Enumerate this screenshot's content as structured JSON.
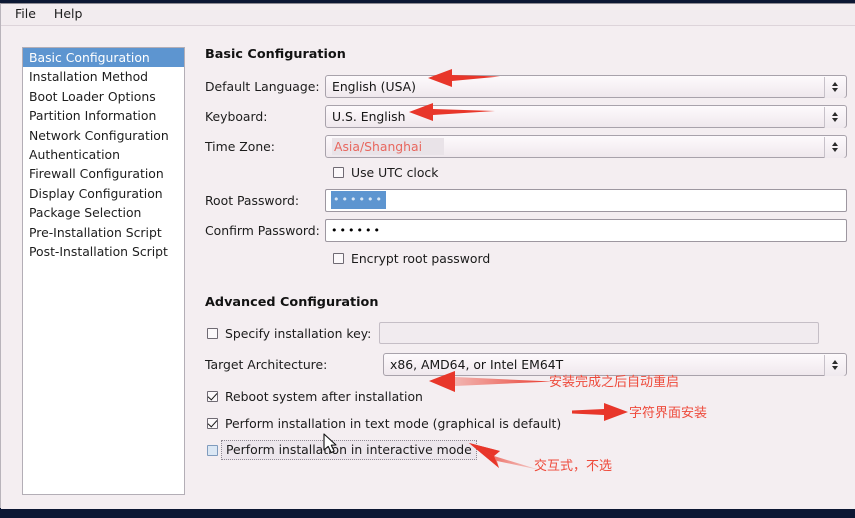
{
  "window": {
    "menubar": [
      {
        "label": "File",
        "name": "menu-file"
      },
      {
        "label": "Help",
        "name": "menu-help"
      }
    ]
  },
  "sidebar": {
    "items": [
      {
        "label": "Basic Configuration",
        "selected": true
      },
      {
        "label": "Installation Method",
        "selected": false
      },
      {
        "label": "Boot Loader Options",
        "selected": false
      },
      {
        "label": "Partition Information",
        "selected": false
      },
      {
        "label": "Network Configuration",
        "selected": false
      },
      {
        "label": "Authentication",
        "selected": false
      },
      {
        "label": "Firewall Configuration",
        "selected": false
      },
      {
        "label": "Display Configuration",
        "selected": false
      },
      {
        "label": "Package Selection",
        "selected": false
      },
      {
        "label": "Pre-Installation Script",
        "selected": false
      },
      {
        "label": "Post-Installation Script",
        "selected": false
      }
    ]
  },
  "basic": {
    "heading": "Basic Configuration",
    "default_language": {
      "label": "Default Language:",
      "value": "English (USA)"
    },
    "keyboard": {
      "label": "Keyboard:",
      "value": "U.S. English"
    },
    "time_zone": {
      "label": "Time Zone:",
      "value": "Asia/Shanghai"
    },
    "use_utc": {
      "label": "Use UTC clock",
      "checked": false
    },
    "root_password": {
      "label": "Root Password:",
      "value": "••••••"
    },
    "confirm_password": {
      "label": "Confirm Password:",
      "value": "••••••"
    },
    "encrypt_root": {
      "label": "Encrypt root password",
      "checked": false
    }
  },
  "advanced": {
    "heading": "Advanced Configuration",
    "specify_key": {
      "label": "Specify installation key:",
      "checked": false,
      "value": ""
    },
    "target_arch": {
      "label": "Target Architecture:",
      "value": "x86, AMD64, or Intel EM64T"
    },
    "reboot_after": {
      "label": "Reboot system after installation",
      "checked": true
    },
    "text_mode": {
      "label": "Perform installation in text mode (graphical is default)",
      "checked": true
    },
    "interactive_mode": {
      "label": "Perform installation in interactive mode",
      "checked": false
    }
  },
  "annotations": {
    "color": "#ee4b3c",
    "notes": [
      {
        "text": "安装完成之后自动重启",
        "name": "annotation-reboot"
      },
      {
        "text": "字符界面安装",
        "name": "annotation-text-mode"
      },
      {
        "text": "交互式，不选",
        "name": "annotation-interactive"
      }
    ]
  },
  "colors": {
    "window_bg": "#f4eef1",
    "selection_blue": "#5d95d0",
    "annotation_red": "#ee4b3c",
    "timezone_red": "#e8675f",
    "desktop": "#0c1733"
  }
}
